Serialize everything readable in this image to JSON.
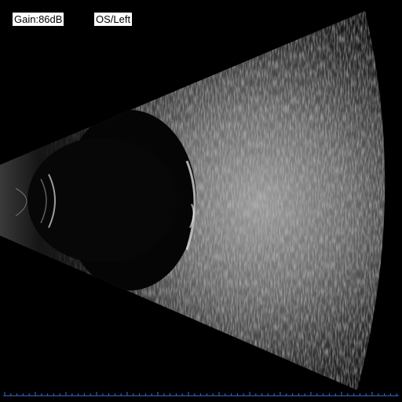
{
  "overlay": {
    "gain": "Gain:86dB",
    "eye": "OS/Left"
  },
  "colors": {
    "background": "#000000",
    "ruler": "#3a6cc8",
    "label_background": "#ffffff",
    "label_text": "#000000"
  }
}
